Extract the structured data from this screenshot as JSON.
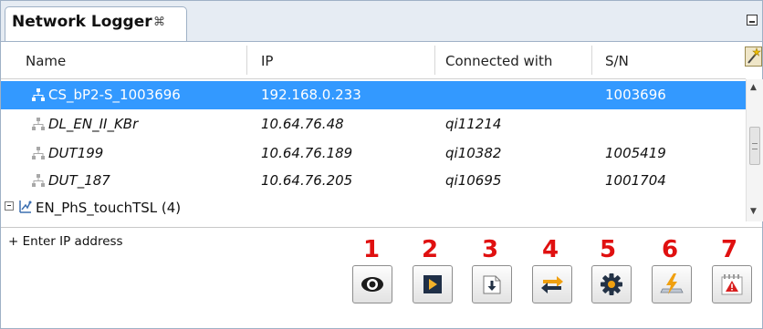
{
  "panel": {
    "tab_title": "Network Logger",
    "tab_close_glyph": "⌘",
    "minimize_icon": "minimize-icon"
  },
  "table": {
    "columns": [
      "Name",
      "IP",
      "Connected with",
      "S/N"
    ],
    "rows": [
      {
        "name": "CS_bP2-S_1003696",
        "ip": "192.168.0.233",
        "connected_with": "",
        "sn": "1003696",
        "selected": true,
        "italic": false
      },
      {
        "name": "DL_EN_II_KBr",
        "ip": "10.64.76.48",
        "connected_with": "qi11214",
        "sn": "",
        "selected": false,
        "italic": true
      },
      {
        "name": "DUT199",
        "ip": "10.64.76.189",
        "connected_with": "qi10382",
        "sn": "1005419",
        "selected": false,
        "italic": true
      },
      {
        "name": "DUT_187",
        "ip": "10.64.76.205",
        "connected_with": "qi10695",
        "sn": "1001704",
        "selected": false,
        "italic": true
      }
    ],
    "group": {
      "label": "EN_PhS_touchTSL (4)"
    }
  },
  "enter_ip_label": "+ Enter IP address",
  "buttons": [
    {
      "number": "1",
      "icon": "eye-icon"
    },
    {
      "number": "2",
      "icon": "play-icon"
    },
    {
      "number": "3",
      "icon": "download-icon"
    },
    {
      "number": "4",
      "icon": "swap-arrows-icon"
    },
    {
      "number": "5",
      "icon": "gear-icon"
    },
    {
      "number": "6",
      "icon": "flash-icon"
    },
    {
      "number": "7",
      "icon": "warning-icon"
    }
  ],
  "colors": {
    "selection": "#3399ff",
    "number_labels": "#e01010",
    "swap_arrow": "#f0a010"
  }
}
